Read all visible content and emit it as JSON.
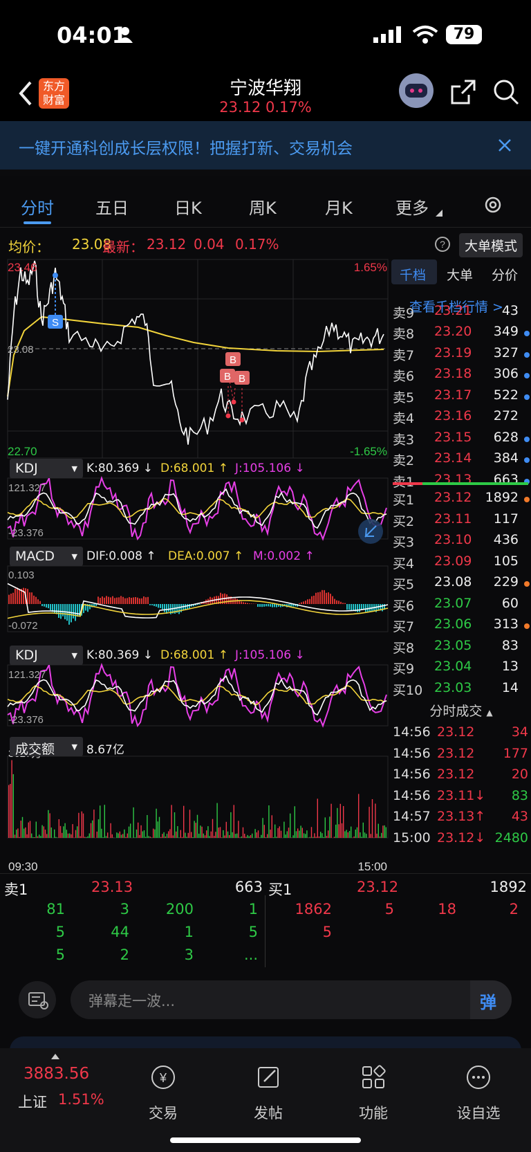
{
  "status": {
    "time": "04:01",
    "battery": "79"
  },
  "nav": {
    "title": "宁波华翔",
    "price": "23.12",
    "change": "0.17%",
    "logo_line1": "东方",
    "logo_line2": "财富"
  },
  "banner": {
    "text": "一键开通科创成长层权限！把握打新、交易机会"
  },
  "tabs": [
    "分时",
    "五日",
    "日K",
    "周K",
    "月K",
    "更多"
  ],
  "priceinfo": {
    "avg_label": "均价：",
    "avg": "23.08",
    "last_label": "最新：",
    "last": "23.12",
    "chg": "0.04",
    "pct": "0.17%",
    "mode": "大单模式"
  },
  "chart": {
    "ymax": "23.46",
    "ymin": "22.70",
    "pmax": "1.65%",
    "pmin": "-1.65%",
    "mid": "23.08",
    "start": "09:30",
    "end": "15:00"
  },
  "kdj": {
    "name": "KDJ",
    "k": "K:80.369 ↓",
    "d": "D:68.001 ↑",
    "j": "J:105.106 ↓",
    "top": "121.327",
    "bot": "-23.376"
  },
  "macd": {
    "name": "MACD",
    "dif": "DIF:0.008 ↑",
    "dea": "DEA:0.007 ↑",
    "m": "M:0.002 ↑",
    "top": "0.103",
    "bot": "-0.072"
  },
  "volume": {
    "name": "成交额",
    "total": "8.67亿",
    "max": "3627万"
  },
  "side": {
    "tabs": [
      "千档",
      "大单",
      "分价"
    ],
    "link": "查看千档行情 >",
    "asks": [
      {
        "l": "卖9",
        "p": "23.21",
        "v": "43",
        "dot": ""
      },
      {
        "l": "卖8",
        "p": "23.20",
        "v": "349",
        "dot": "#3f8cf3"
      },
      {
        "l": "卖7",
        "p": "23.19",
        "v": "327",
        "dot": "#3f8cf3"
      },
      {
        "l": "卖6",
        "p": "23.18",
        "v": "306",
        "dot": "#3f8cf3"
      },
      {
        "l": "卖5",
        "p": "23.17",
        "v": "522",
        "dot": "#3f8cf3"
      },
      {
        "l": "卖4",
        "p": "23.16",
        "v": "272",
        "dot": ""
      },
      {
        "l": "卖3",
        "p": "23.15",
        "v": "628",
        "dot": "#3f8cf3"
      },
      {
        "l": "卖2",
        "p": "23.14",
        "v": "384",
        "dot": "#3f8cf3"
      },
      {
        "l": "卖1",
        "p": "23.13",
        "v": "663",
        "dot": "#3f8cf3"
      }
    ],
    "bids": [
      {
        "l": "买1",
        "p": "23.12",
        "v": "1892",
        "dot": "#f27a2a",
        "c": "red"
      },
      {
        "l": "买2",
        "p": "23.11",
        "v": "117",
        "dot": "",
        "c": "red"
      },
      {
        "l": "买3",
        "p": "23.10",
        "v": "436",
        "dot": "",
        "c": "red"
      },
      {
        "l": "买4",
        "p": "23.09",
        "v": "105",
        "dot": "",
        "c": "red"
      },
      {
        "l": "买5",
        "p": "23.08",
        "v": "229",
        "dot": "#f27a2a",
        "c": "white"
      },
      {
        "l": "买6",
        "p": "23.07",
        "v": "60",
        "dot": "",
        "c": "green"
      },
      {
        "l": "买7",
        "p": "23.06",
        "v": "313",
        "dot": "#f27a2a",
        "c": "green"
      },
      {
        "l": "买8",
        "p": "23.05",
        "v": "83",
        "dot": "",
        "c": "green"
      },
      {
        "l": "买9",
        "p": "23.04",
        "v": "13",
        "dot": "",
        "c": "green"
      },
      {
        "l": "买10",
        "p": "23.03",
        "v": "14",
        "dot": "",
        "c": "green"
      }
    ],
    "trades_title": "分时成交",
    "trades": [
      {
        "t": "14:56",
        "p": "23.12",
        "v": "34",
        "pc": "red",
        "vc": "red"
      },
      {
        "t": "14:56",
        "p": "23.12",
        "v": "177",
        "pc": "red",
        "vc": "red"
      },
      {
        "t": "14:56",
        "p": "23.12",
        "v": "20",
        "pc": "red",
        "vc": "red"
      },
      {
        "t": "14:56",
        "p": "23.11↓",
        "v": "83",
        "pc": "red",
        "vc": "green"
      },
      {
        "t": "14:57",
        "p": "23.13↑",
        "v": "43",
        "pc": "red",
        "vc": "red"
      },
      {
        "t": "15:00",
        "p": "23.12↓",
        "v": "2480",
        "pc": "red",
        "vc": "green"
      }
    ]
  },
  "queue": {
    "sell_label": "卖1",
    "sell_price": "23.13",
    "sell_total": "663",
    "buy_label": "买1",
    "buy_price": "23.12",
    "buy_total": "1892",
    "sell_cells": [
      "81",
      "3",
      "200",
      "1",
      "5",
      "44",
      "1",
      "5",
      "5",
      "2",
      "3",
      "..."
    ],
    "buy_cells": [
      "1862",
      "5",
      "18",
      "2",
      "5"
    ]
  },
  "danmu": {
    "placeholder": "弹幕走一波...",
    "send": "弹"
  },
  "bottom": {
    "index_value": "3883.56",
    "index_name": "上证",
    "index_pct": "1.51%",
    "items": [
      "交易",
      "发帖",
      "功能",
      "设自选"
    ]
  },
  "colors": {
    "red": "#f0384a",
    "green": "#2ec946",
    "yellow": "#f2d43b",
    "blue": "#4b9af0",
    "magenta": "#e63fe6"
  },
  "markers": {
    "sell": "S",
    "buy": "B"
  }
}
